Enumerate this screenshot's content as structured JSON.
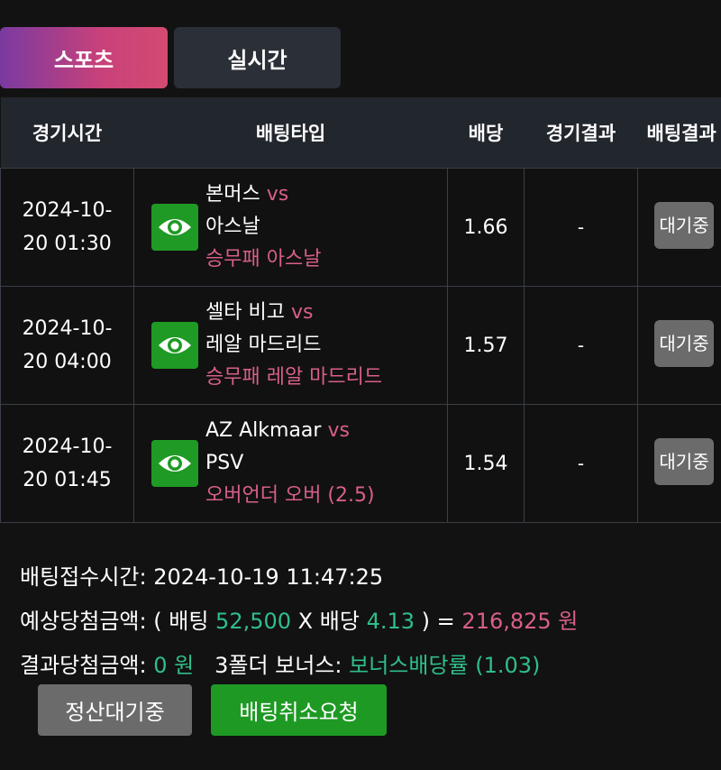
{
  "tabs": {
    "sports": "스포츠",
    "live": "실시간"
  },
  "table": {
    "headers": [
      "경기시간",
      "배팅타입",
      "배당",
      "경기결과",
      "배팅결과"
    ],
    "rows": [
      {
        "time_l1": "2024-10-",
        "time_l2": "20 01:30",
        "home": "본머스",
        "vs": "vs",
        "away": "아스날",
        "pick": "승무패 아스날",
        "odds": "1.66",
        "result": "-",
        "status": "대기중"
      },
      {
        "time_l1": "2024-10-",
        "time_l2": "20 04:00",
        "home": "셀타 비고",
        "vs": "vs",
        "away": "레알 마드리드",
        "pick": "승무패 레알 마드리드",
        "odds": "1.57",
        "result": "-",
        "status": "대기중"
      },
      {
        "time_l1": "2024-10-",
        "time_l2": "20 01:45",
        "home": "AZ Alkmaar",
        "vs": "vs",
        "away": "PSV",
        "pick": "오버언더 오버 (2.5)",
        "odds": "1.54",
        "result": "-",
        "status": "대기중"
      }
    ]
  },
  "summary": {
    "time_label": "배팅접수시간:",
    "time_value": "2024-10-19 11:47:25",
    "expected_label": "예상당첨금액:",
    "open_paren": "(",
    "bet_label": "배팅",
    "bet_amount": "52,500",
    "x_sign": "X",
    "odds_label": "배당",
    "total_odds": "4.13",
    "close_paren": ")",
    "equals": "=",
    "expected_amount": "216,825 원",
    "result_label": "결과당첨금액:",
    "result_amount": "0 원",
    "bonus_label": "3폴더 보너스:",
    "bonus_value": "보너스배당률 (1.03)"
  },
  "buttons": {
    "settle_wait": "정산대기중",
    "cancel_request": "배팅취소요청"
  },
  "icons": {
    "view": "eye-icon"
  },
  "colors": {
    "accent_pink": "#d85f8a",
    "accent_green": "#2fbf8a",
    "button_green": "#1e9a24",
    "background": "#121212"
  }
}
